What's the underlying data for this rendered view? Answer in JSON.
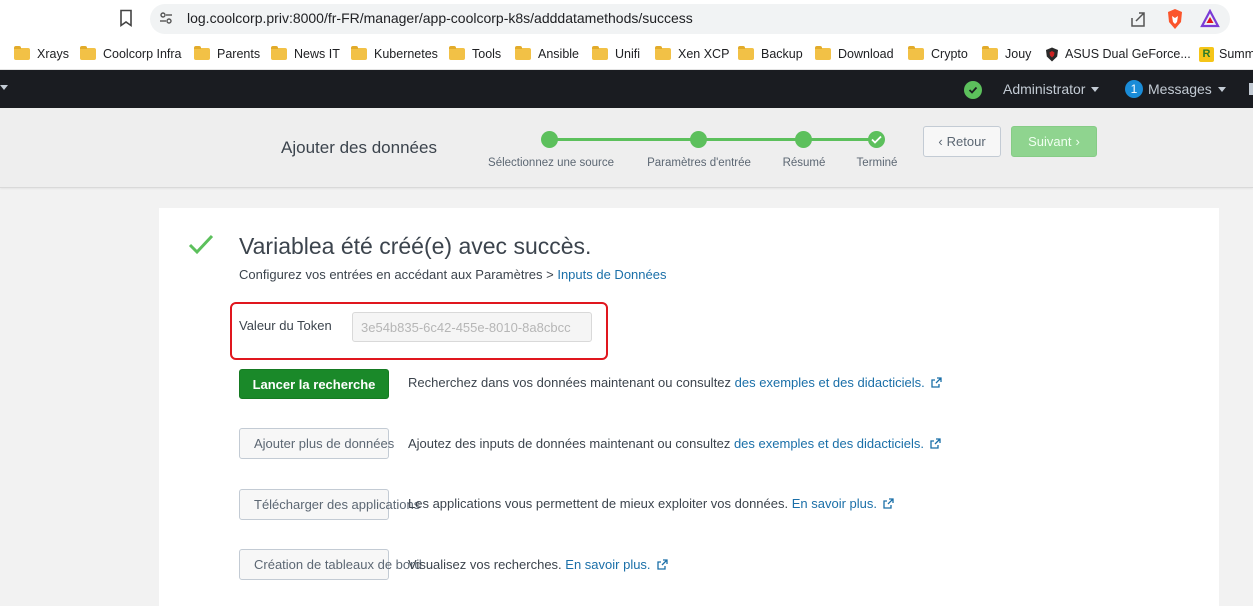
{
  "browser": {
    "url": "log.coolcorp.priv:8000/fr-FR/manager/app-coolcorp-k8s/adddatamethods/success",
    "bookmarks": [
      {
        "label": "Xrays",
        "icon": "folder-icon"
      },
      {
        "label": "Coolcorp Infra",
        "icon": "folder-icon"
      },
      {
        "label": "Parents",
        "icon": "folder-icon"
      },
      {
        "label": "News IT",
        "icon": "folder-icon"
      },
      {
        "label": "Kubernetes",
        "icon": "folder-icon"
      },
      {
        "label": "Tools",
        "icon": "folder-icon"
      },
      {
        "label": "Ansible",
        "icon": "folder-icon"
      },
      {
        "label": "Unifi",
        "icon": "folder-icon"
      },
      {
        "label": "Xen XCP",
        "icon": "folder-icon"
      },
      {
        "label": "Backup",
        "icon": "folder-icon"
      },
      {
        "label": "Download",
        "icon": "folder-icon"
      },
      {
        "label": "Crypto",
        "icon": "folder-icon"
      },
      {
        "label": "Jouy",
        "icon": "folder-icon"
      },
      {
        "label": "ASUS Dual GeForce...",
        "icon": "shield-icon"
      },
      {
        "label": "Summ",
        "icon": "r-logo-icon"
      }
    ]
  },
  "header": {
    "user_menu": "Administrator",
    "messages_count": "1",
    "messages_label": "Messages"
  },
  "wizard": {
    "title": "Ajouter des données",
    "steps": [
      {
        "label": "Sélectionnez une source"
      },
      {
        "label": "Paramètres d'entrée"
      },
      {
        "label": "Résumé"
      },
      {
        "label": "Terminé"
      }
    ],
    "back_label": "Retour",
    "next_label": "Suivant"
  },
  "success": {
    "title": "Variablea été créé(e) avec succès.",
    "subtitle_prefix": "Configurez vos entrées en accédant aux Paramètres > ",
    "subtitle_link": "Inputs de Données"
  },
  "token": {
    "label": "Valeur du Token",
    "value": "3e54b835-6c42-455e-8010-8a8cbcc"
  },
  "actions": [
    {
      "button": "Lancer la recherche",
      "text": "Recherchez dans vos données maintenant ou consultez ",
      "link": "des exemples et des didacticiels."
    },
    {
      "button": "Ajouter plus de données",
      "text": "Ajoutez des inputs de données maintenant ou consultez ",
      "link": "des exemples et des didacticiels."
    },
    {
      "button": "Télécharger des applications",
      "text": "Les applications vous permettent de mieux exploiter vos données. ",
      "link": "En savoir plus."
    },
    {
      "button": "Création de tableaux de bord",
      "text": "Visualisez vos recherches. ",
      "link": "En savoir plus."
    }
  ],
  "colors": {
    "accent_green": "#5cc05c",
    "primary_button": "#1a8929",
    "link": "#1a6fa8",
    "highlight_red": "#e0161e"
  }
}
